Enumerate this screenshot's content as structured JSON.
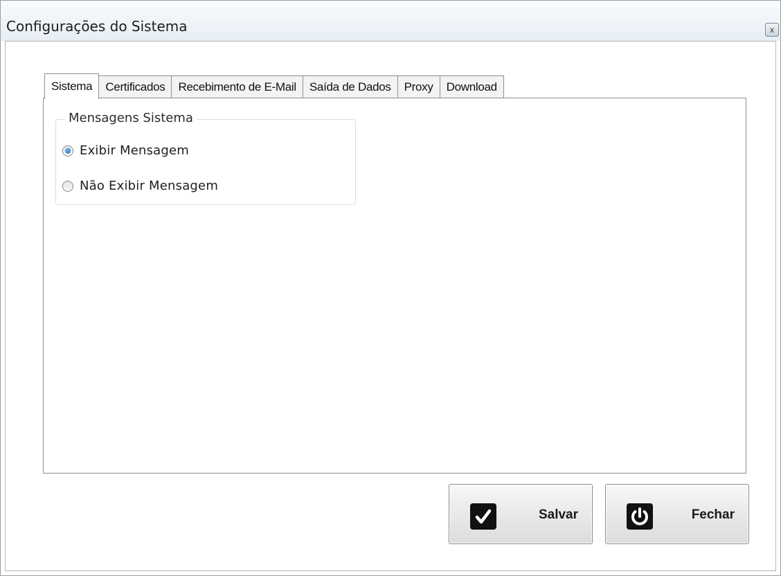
{
  "window": {
    "title": "Configurações do Sistema",
    "close_glyph": "x"
  },
  "tabs": [
    {
      "label": "Sistema",
      "selected": true
    },
    {
      "label": "Certificados",
      "selected": false
    },
    {
      "label": "Recebimento de E-Mail",
      "selected": false
    },
    {
      "label": "Saída de Dados",
      "selected": false
    },
    {
      "label": "Proxy",
      "selected": false
    },
    {
      "label": "Download",
      "selected": false
    }
  ],
  "messages_group": {
    "title": "Mensagens Sistema",
    "options": [
      {
        "label": "Exibir Mensagem",
        "checked": true
      },
      {
        "label": "Não Exibir Mensagem",
        "checked": false
      }
    ]
  },
  "buttons": {
    "save": {
      "label": "Salvar",
      "icon": "checkmark-icon"
    },
    "close": {
      "label": "Fechar",
      "icon": "power-icon"
    }
  },
  "colors": {
    "radio_accent": "#1f64b8",
    "icon_background": "#111111"
  }
}
